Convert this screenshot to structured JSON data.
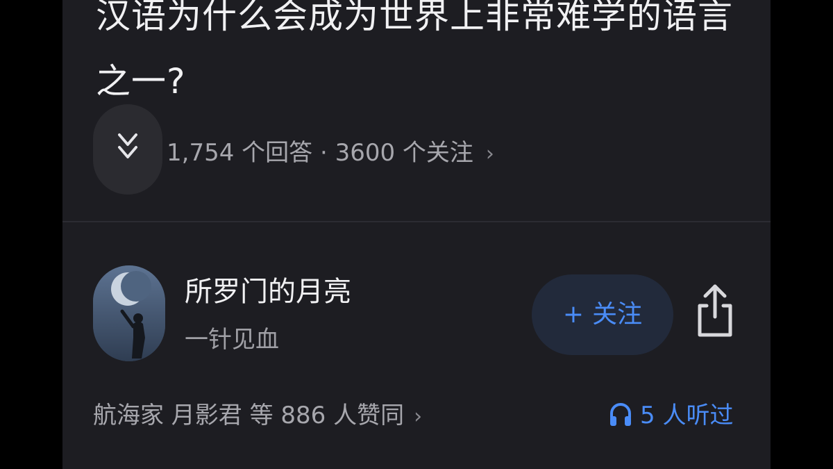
{
  "question": {
    "title": "汉语为什么会成为世界上非常难学的语言之一?",
    "meta": "1,754 个回答 · 3600 个关注",
    "meta_chevron": "›",
    "collapse_icon": "double-chevron-down-icon"
  },
  "answer": {
    "author_name": "所罗门的月亮",
    "author_bio": "一针见血",
    "follow_plus": "+",
    "follow_label": "关注",
    "share_icon": "share-icon",
    "likes_text": "航海家 月影君 等 886 人赞同",
    "likes_chevron": "›",
    "listened_text": "5 人听过",
    "headphone_icon": "headphone-icon"
  },
  "colors": {
    "background": "#1d1d22",
    "accent": "#4a8cf7",
    "primary_text": "#f1f1f3",
    "secondary_text": "#a7a7ad"
  }
}
